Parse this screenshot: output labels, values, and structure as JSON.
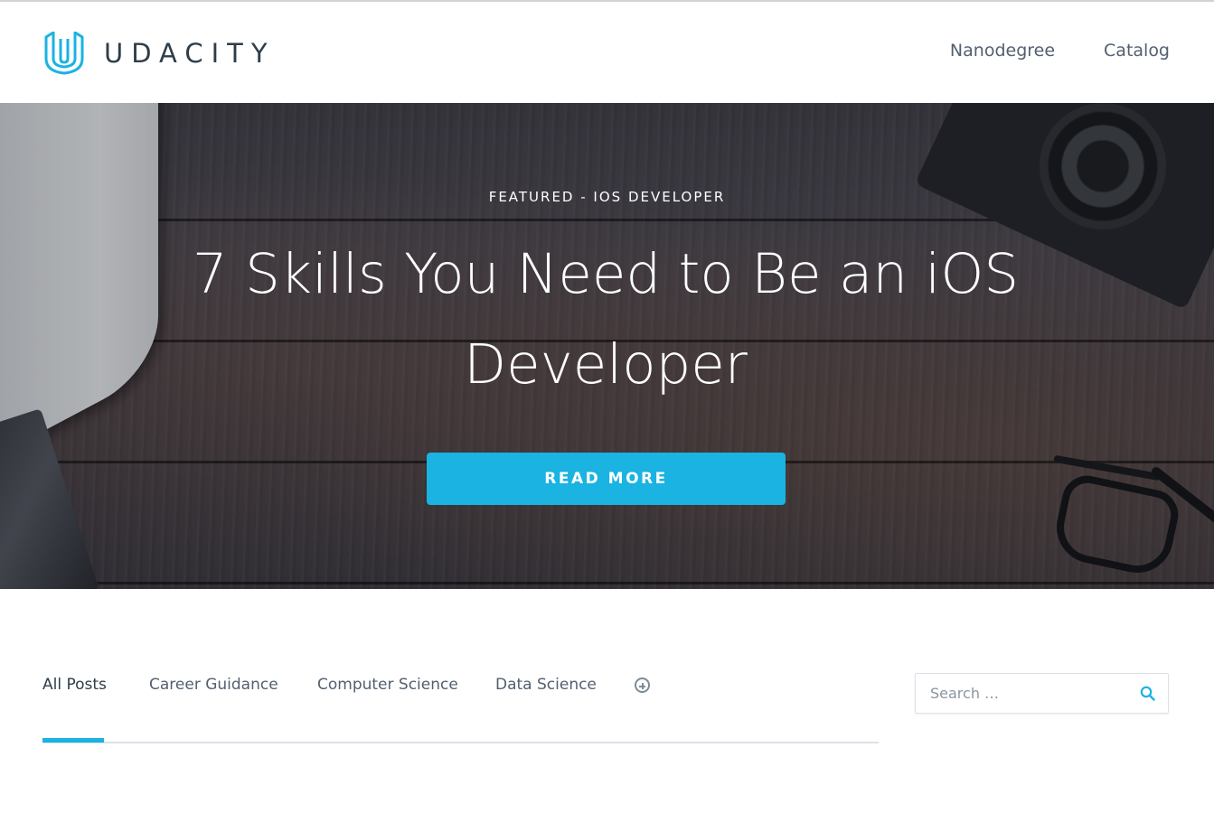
{
  "brand": {
    "name": "UDACITY",
    "accent_color": "#1ab3e2"
  },
  "nav": {
    "items": [
      {
        "label": "Nanodegree"
      },
      {
        "label": "Catalog"
      }
    ]
  },
  "hero": {
    "eyebrow": "FEATURED - IOS DEVELOPER",
    "title": "7 Skills You Need to Be an iOS Developer",
    "cta_label": "READ MORE"
  },
  "tabs": {
    "items": [
      {
        "label": "All Posts",
        "active": true
      },
      {
        "label": "Career Guidance",
        "active": false
      },
      {
        "label": "Computer Science",
        "active": false
      },
      {
        "label": "Data Science",
        "active": false
      }
    ],
    "more_icon": "plus-circle-icon"
  },
  "search": {
    "placeholder": "Search …",
    "value": "",
    "icon": "search-icon"
  }
}
